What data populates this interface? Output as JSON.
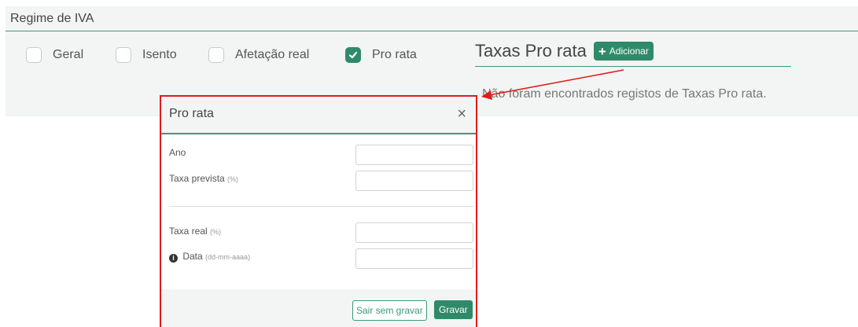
{
  "section": {
    "title": "Regime de IVA",
    "options": [
      {
        "label": "Geral",
        "checked": false
      },
      {
        "label": "Isento",
        "checked": false
      },
      {
        "label": "Afetação real",
        "checked": false
      },
      {
        "label": "Pro rata",
        "checked": true
      }
    ]
  },
  "taxas": {
    "title": "Taxas Pro rata",
    "add_label": "Adicionar",
    "empty_message": "Não foram encontrados registos de Taxas Pro rata."
  },
  "modal": {
    "title": "Pro rata",
    "close_symbol": "×",
    "fields": {
      "ano": {
        "label": "Ano",
        "value": ""
      },
      "taxa_prevista": {
        "label": "Taxa prevista",
        "hint": "(%)",
        "value": ""
      },
      "taxa_real": {
        "label": "Taxa real",
        "hint": "(%)",
        "value": ""
      },
      "data": {
        "label": "Data",
        "hint": "(dd-mm-aaaa)",
        "value": ""
      }
    },
    "cancel_label": "Sair sem gravar",
    "save_label": "Gravar"
  },
  "colors": {
    "accent": "#2e8b6a",
    "highlight": "#e11b1b"
  }
}
